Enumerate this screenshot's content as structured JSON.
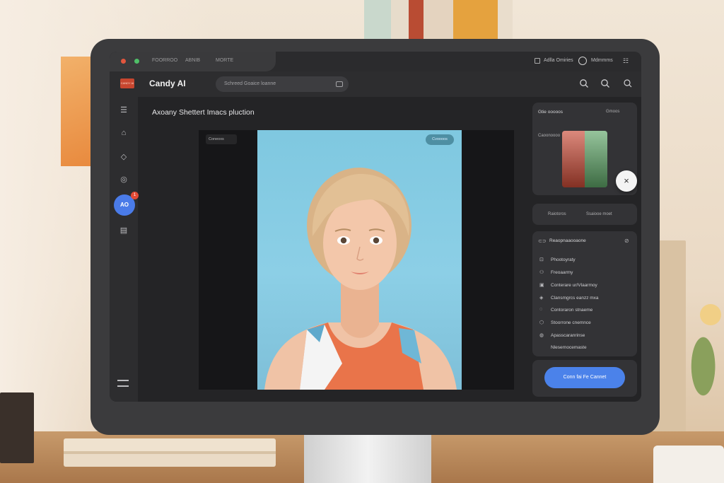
{
  "window": {
    "menu": [
      "FOORROO",
      "ABNIB",
      "MORTE"
    ],
    "account_label": "Adlla Omiries",
    "user_label": "Mdmmms"
  },
  "header": {
    "logo_badge": "CANDY AI",
    "app_name": "Candy AI",
    "search_placeholder": "Schreed Goaice loanne"
  },
  "rail": {
    "items": [
      "list-icon",
      "shop-icon",
      "tag-icon",
      "chat-icon",
      "book-icon"
    ],
    "active_label": "AO",
    "badge": "1"
  },
  "main": {
    "title": "Axoany Shettert  Imacs pluction",
    "canvas_tag": "Coneoxs",
    "photo_pill": "Cvoooos"
  },
  "panels": {
    "palette": {
      "title": "Gtie ooooos",
      "dropdown": "Gmoos",
      "caption": "Caoonoooo"
    },
    "tools": {
      "label_a": "Raiotoros",
      "label_b": "Ssaiooe moet"
    },
    "styles": {
      "title": "Reaopnaaooaone",
      "items": [
        {
          "icon": "⊡",
          "label": "Phootoyraty"
        },
        {
          "icon": "⚇",
          "label": "Freoaarmy"
        },
        {
          "icon": "▣",
          "label": "Conterare ur/Vlaarmoy"
        },
        {
          "icon": "◈",
          "label": "Clansmgrcs eanzz mxa"
        },
        {
          "icon": "◌",
          "label": "Contoraron stnaeme"
        },
        {
          "icon": "⬡",
          "label": "Stoorrone cnemnce"
        },
        {
          "icon": "◍",
          "label": "Apasscaranrinse"
        },
        {
          "icon": "",
          "label": "Nlesernocemaste"
        }
      ]
    },
    "cta_label": "Conn fai Fe Cannet"
  }
}
